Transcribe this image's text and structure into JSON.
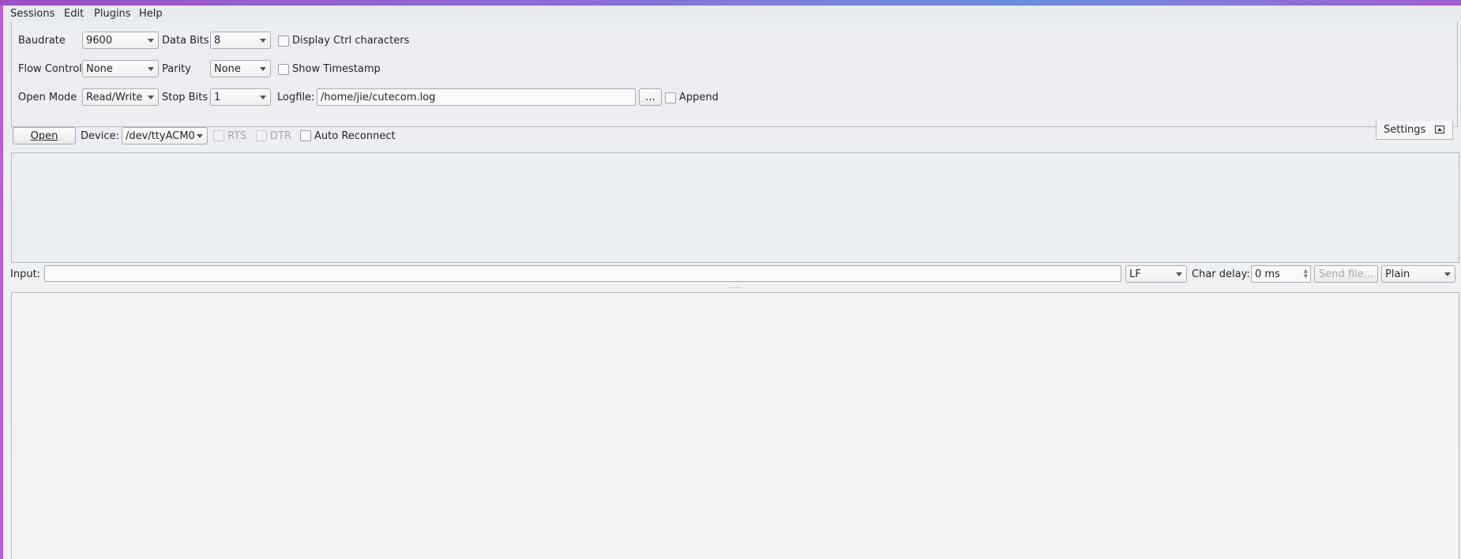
{
  "menu": {
    "sessions": "Sessions",
    "edit": "Edit",
    "plugins": "Plugins",
    "help": "Help"
  },
  "settings": {
    "baudrate_label": "Baudrate",
    "baudrate_value": "9600",
    "databits_label": "Data Bits",
    "databits_value": "8",
    "display_ctrl_label": "Display Ctrl characters",
    "flow_label": "Flow Control",
    "flow_value": "None",
    "parity_label": "Parity",
    "parity_value": "None",
    "show_timestamp_label": "Show Timestamp",
    "openmode_label": "Open Mode",
    "openmode_value": "Read/Write",
    "stopbits_label": "Stop Bits",
    "stopbits_value": "1",
    "logfile_label": "Logfile:",
    "logfile_value": "/home/jie/cutecom.log",
    "browse_label": "...",
    "append_label": "Append"
  },
  "connection": {
    "open_label": "Open",
    "device_label": "Device:",
    "device_value": "/dev/ttyACM0",
    "rts_label": "RTS",
    "dtr_label": "DTR",
    "auto_reconnect_label": "Auto Reconnect",
    "settings_tab_label": "Settings"
  },
  "input_bar": {
    "input_label": "Input:",
    "input_value": "",
    "line_end_value": "LF",
    "char_delay_label": "Char delay:",
    "char_delay_value": "0 ms",
    "send_file_label": "Send file...",
    "format_value": "Plain"
  }
}
